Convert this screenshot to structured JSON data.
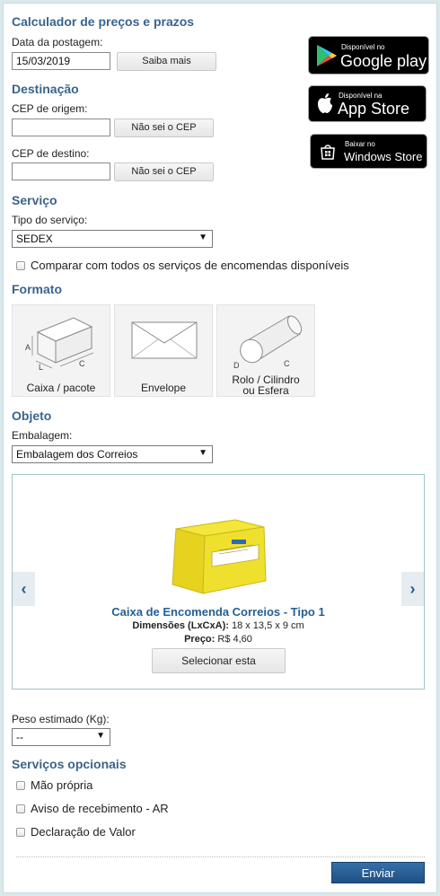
{
  "header": {
    "title": "Calculador de preços e prazos"
  },
  "postage": {
    "date_label": "Data da postagem:",
    "date_value": "15/03/2019",
    "learn_more": "Saiba mais"
  },
  "destination": {
    "title": "Destinação",
    "origin_label": "CEP de origem:",
    "origin_value": "",
    "origin_button": "Não sei o CEP",
    "dest_label": "CEP de destino:",
    "dest_value": "",
    "dest_button": "Não sei o CEP"
  },
  "stores": {
    "google": {
      "small": "Disponível no",
      "big": "Google play"
    },
    "apple": {
      "small": "Disponível na",
      "big": "App Store"
    },
    "windows": {
      "small": "Baixar no",
      "big": "Windows Store"
    }
  },
  "service": {
    "title": "Serviço",
    "type_label": "Tipo do serviço:",
    "type_value": "SEDEX",
    "compare_label": "Comparar com todos os serviços de encomendas disponíveis"
  },
  "format": {
    "title": "Formato",
    "options": [
      {
        "label": "Caixa / pacote",
        "dims": [
          "A",
          "L",
          "C"
        ]
      },
      {
        "label": "Envelope"
      },
      {
        "label_line1": "Rolo / Cilindro",
        "label_line2": "ou Esfera",
        "dims": [
          "D",
          "C"
        ]
      }
    ]
  },
  "object": {
    "title": "Objeto",
    "packaging_label": "Embalagem:",
    "packaging_value": "Embalagem dos Correios",
    "carousel": {
      "item_title": "Caixa de Encomenda Correios - Tipo 1",
      "dims_label": "Dimensões (LxCxA):",
      "dims_value": "18 x 13,5 x 9 cm",
      "price_label": "Preço:",
      "price_value": "R$ 4,60",
      "select_button": "Selecionar esta",
      "prev": "‹",
      "next": "›"
    }
  },
  "weight": {
    "label": "Peso estimado (Kg):",
    "value": "--"
  },
  "optional": {
    "title": "Serviços opcionais",
    "items": [
      "Mão própria",
      "Aviso de recebimento - AR",
      "Declaração de Valor"
    ]
  },
  "submit": {
    "label": "Enviar"
  },
  "colors": {
    "heading": "#3a648b",
    "link": "#245f94",
    "submit": "#2a5f98"
  }
}
